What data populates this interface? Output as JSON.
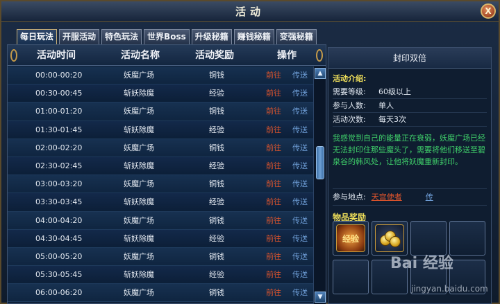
{
  "window": {
    "title": "活动",
    "close_label": "X"
  },
  "tabs": [
    "每日玩法",
    "开服活动",
    "特色玩法",
    "世界Boss",
    "升级秘籍",
    "赚钱秘籍",
    "变强秘籍"
  ],
  "table": {
    "headers": {
      "time": "活动时间",
      "name": "活动名称",
      "reward": "活动奖励",
      "action": "操作"
    },
    "go_label": "前往",
    "teleport_label": "传送",
    "rows": [
      {
        "time": "00:00-00:20",
        "name": "妖魔广场",
        "reward": "铜钱"
      },
      {
        "time": "00:30-00:45",
        "name": "斩妖除魔",
        "reward": "经验"
      },
      {
        "time": "01:00-01:20",
        "name": "妖魔广场",
        "reward": "铜钱"
      },
      {
        "time": "01:30-01:45",
        "name": "斩妖除魔",
        "reward": "经验"
      },
      {
        "time": "02:00-02:20",
        "name": "妖魔广场",
        "reward": "铜钱"
      },
      {
        "time": "02:30-02:45",
        "name": "斩妖除魔",
        "reward": "经验"
      },
      {
        "time": "03:00-03:20",
        "name": "妖魔广场",
        "reward": "铜钱"
      },
      {
        "time": "03:30-03:45",
        "name": "斩妖除魔",
        "reward": "经验"
      },
      {
        "time": "04:00-04:20",
        "name": "妖魔广场",
        "reward": "铜钱"
      },
      {
        "time": "04:30-04:45",
        "name": "斩妖除魔",
        "reward": "经验"
      },
      {
        "time": "05:00-05:20",
        "name": "妖魔广场",
        "reward": "铜钱"
      },
      {
        "time": "05:30-05:45",
        "name": "斩妖除魔",
        "reward": "经验"
      },
      {
        "time": "06:00-06:20",
        "name": "妖魔广场",
        "reward": "铜钱"
      }
    ]
  },
  "detail": {
    "title": "封印双倍",
    "intro_label": "活动介绍:",
    "level_label": "需要等级:",
    "level_value": "60级以上",
    "players_label": "参与人数:",
    "players_value": "单人",
    "times_label": "活动次数:",
    "times_value": "每天3次",
    "description": "我感觉到自己的能量正在衰弱，妖魔广场已经无法封印住那些魔头了，需要将他们移送至碧泉谷的韩风处，让他将妖魔重新封印。",
    "location_label": "参与地点:",
    "location_npc": "天宫使者",
    "location_teleport": "传",
    "rewards_label": "物品奖励",
    "reward_item_1_text": "经验"
  },
  "watermark": {
    "main": "Bai 经验",
    "sub": "jingyan.baidu.com"
  },
  "colors": {
    "accent_gold": "#f0e05a",
    "go_red": "#e0552c",
    "teleport_blue": "#6f9fd8",
    "desc_green": "#3fcf6a"
  }
}
